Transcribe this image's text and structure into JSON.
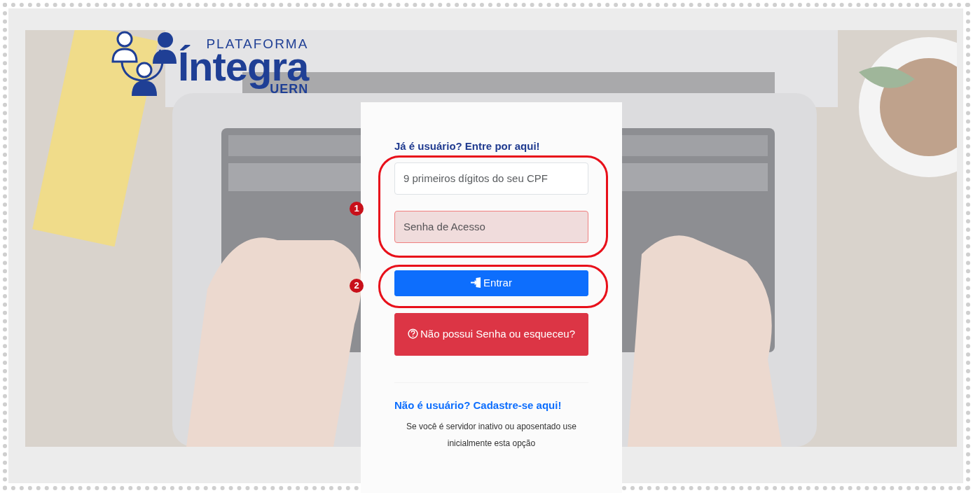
{
  "logo": {
    "overline": "PLATAFORMA",
    "name": "Íntegra",
    "subline": "UERN"
  },
  "login": {
    "heading": "Já é usuário? Entre por aqui!",
    "fields": [
      {
        "placeholder": "9 primeiros dígitos do seu CPF",
        "invalid": false
      },
      {
        "placeholder": "Senha de Acesso",
        "invalid": true
      }
    ],
    "buttons": [
      {
        "kind": "primary",
        "label": "Entrar"
      },
      {
        "kind": "danger",
        "label": "Não possui Senha ou esqueceu?"
      }
    ],
    "register_link": "Não é usuário? Cadastre-se aqui!",
    "note": "Se você é servidor inativo ou aposentado use inicialmente esta opção"
  },
  "annotations": [
    {
      "label": "1"
    },
    {
      "label": "2"
    }
  ]
}
